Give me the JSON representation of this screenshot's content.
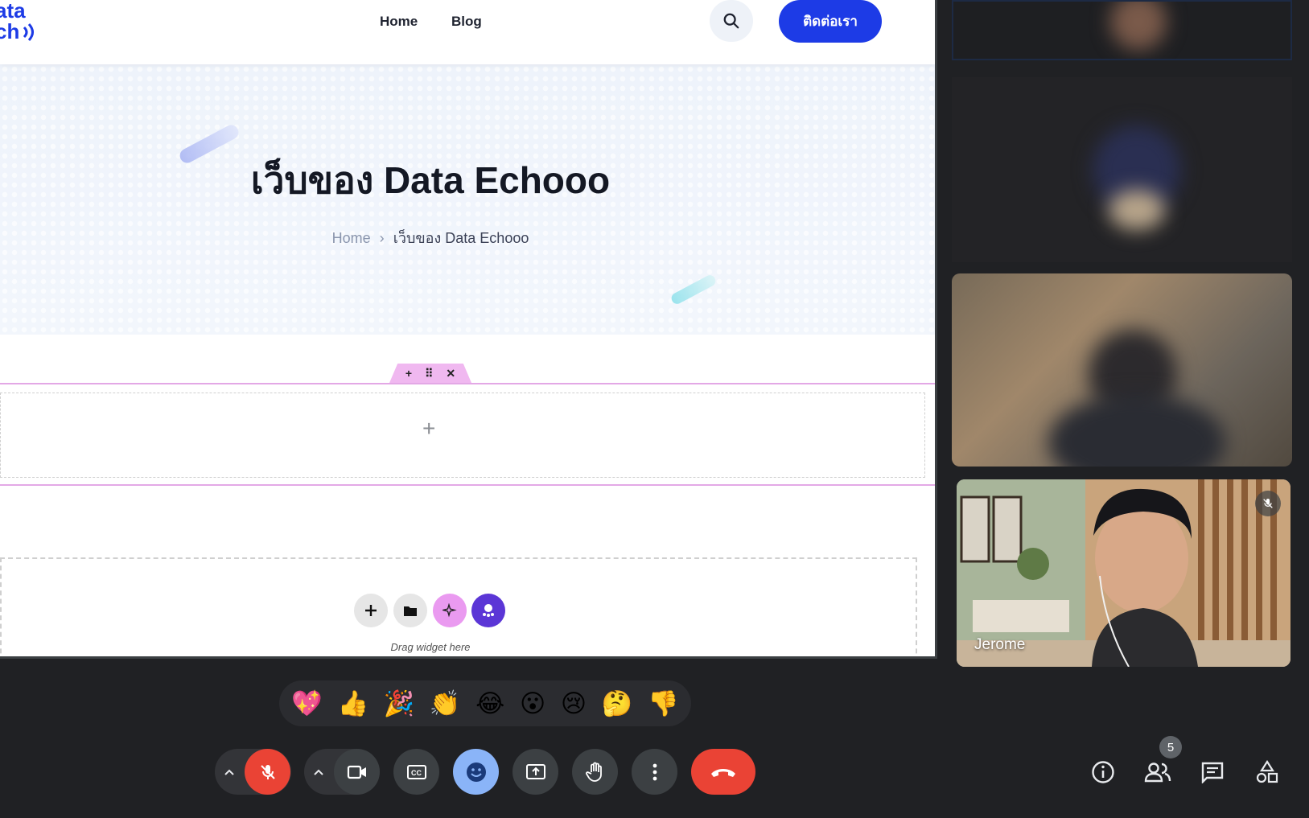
{
  "site": {
    "nav": {
      "home": "Home",
      "blog": "Blog"
    },
    "contact_button": "ติดต่อเรา",
    "hero_title": "เว็บของ Data Echooo",
    "breadcrumb": {
      "home": "Home",
      "separator": "›",
      "current": "เว็บของ Data Echooo"
    },
    "section_toolbar": {
      "add": "+",
      "move": "⠿",
      "close": "✕"
    },
    "add_section": "+",
    "drag_widget": "Drag widget here",
    "accent_color": "#1d3be6"
  },
  "meeting": {
    "participant_name": "Jerome",
    "people_count": "5",
    "reactions": [
      "💖",
      "👍",
      "🎉",
      "👏",
      "😂",
      "😮",
      "😢",
      "🤔",
      "👎"
    ],
    "colors": {
      "end_call": "#ea4335",
      "mic_off": "#ea4335",
      "emoji_active": "#8ab4f8",
      "bar_bg": "#202124"
    },
    "controls": [
      "mic-options",
      "mic-off",
      "camera-options",
      "camera",
      "captions",
      "reactions",
      "present",
      "raise-hand",
      "more-options",
      "end-call"
    ],
    "right_controls": [
      "meeting-info",
      "people",
      "chat",
      "activities"
    ]
  }
}
